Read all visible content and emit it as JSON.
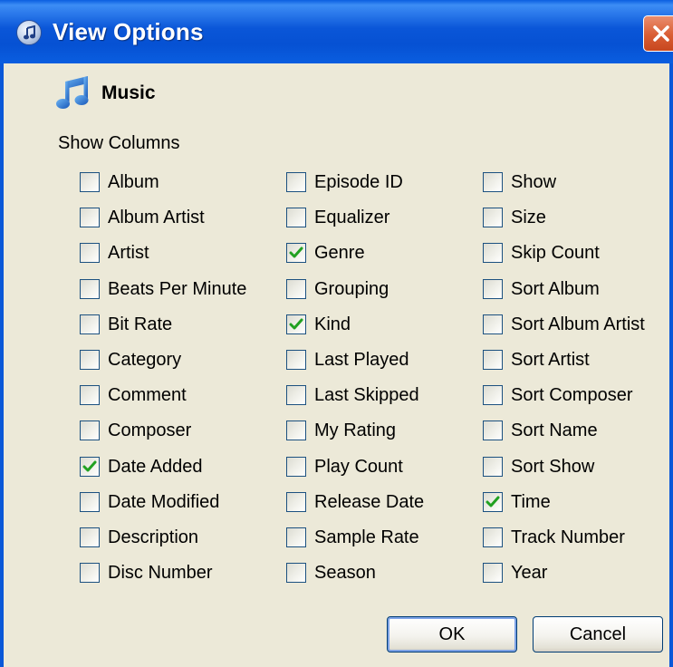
{
  "window": {
    "title": "View Options",
    "close_label": "X"
  },
  "header": {
    "icon": "music-note-icon",
    "title": "Music"
  },
  "section_label": "Show Columns",
  "columns": [
    [
      {
        "label": "Album",
        "checked": false
      },
      {
        "label": "Album Artist",
        "checked": false
      },
      {
        "label": "Artist",
        "checked": false
      },
      {
        "label": "Beats Per Minute",
        "checked": false
      },
      {
        "label": "Bit Rate",
        "checked": false
      },
      {
        "label": "Category",
        "checked": false
      },
      {
        "label": "Comment",
        "checked": false
      },
      {
        "label": "Composer",
        "checked": false
      },
      {
        "label": "Date Added",
        "checked": true
      },
      {
        "label": "Date Modified",
        "checked": false
      },
      {
        "label": "Description",
        "checked": false
      },
      {
        "label": "Disc Number",
        "checked": false
      }
    ],
    [
      {
        "label": "Episode ID",
        "checked": false
      },
      {
        "label": "Equalizer",
        "checked": false
      },
      {
        "label": "Genre",
        "checked": true
      },
      {
        "label": "Grouping",
        "checked": false
      },
      {
        "label": "Kind",
        "checked": true
      },
      {
        "label": "Last Played",
        "checked": false
      },
      {
        "label": "Last Skipped",
        "checked": false
      },
      {
        "label": "My Rating",
        "checked": false
      },
      {
        "label": "Play Count",
        "checked": false
      },
      {
        "label": "Release Date",
        "checked": false
      },
      {
        "label": "Sample Rate",
        "checked": false
      },
      {
        "label": "Season",
        "checked": false
      }
    ],
    [
      {
        "label": "Show",
        "checked": false
      },
      {
        "label": "Size",
        "checked": false
      },
      {
        "label": "Skip Count",
        "checked": false
      },
      {
        "label": "Sort Album",
        "checked": false
      },
      {
        "label": "Sort Album Artist",
        "checked": false
      },
      {
        "label": "Sort Artist",
        "checked": false
      },
      {
        "label": "Sort Composer",
        "checked": false
      },
      {
        "label": "Sort Name",
        "checked": false
      },
      {
        "label": "Sort Show",
        "checked": false
      },
      {
        "label": "Time",
        "checked": true
      },
      {
        "label": "Track Number",
        "checked": false
      },
      {
        "label": "Year",
        "checked": false
      }
    ]
  ],
  "buttons": {
    "ok_label": "OK",
    "cancel_label": "Cancel"
  },
  "colors": {
    "titlebar": "#0a56d8",
    "dialog_background": "#ece9d8",
    "checkmark": "#21a121",
    "close_button": "#d95d33"
  }
}
